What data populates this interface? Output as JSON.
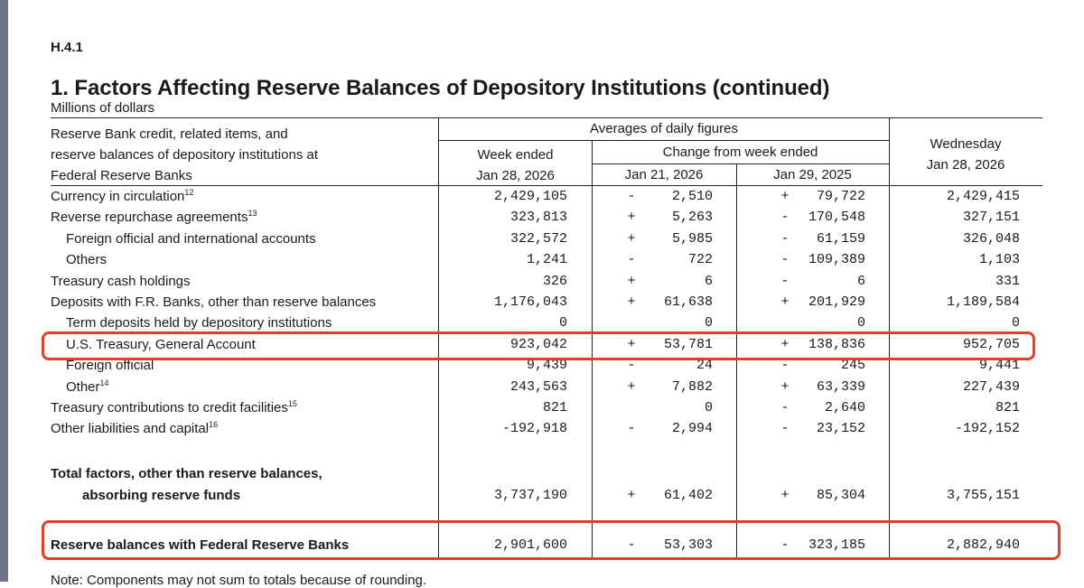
{
  "release_id": "H.4.1",
  "title": "1. Factors Affecting Reserve Balances of Depository Institutions (continued)",
  "units": "Millions of dollars",
  "header": {
    "item_col": [
      "Reserve Bank credit, related items, and",
      "reserve balances of depository institutions at",
      "Federal Reserve Banks"
    ],
    "averages": "Averages of daily figures",
    "week_ended": [
      "Week ended",
      "Jan 28, 2026"
    ],
    "change_from": "Change from week ended",
    "change_col1": "Jan 21, 2026",
    "change_col2": "Jan 29, 2025",
    "wednesday": [
      "Wednesday",
      "Jan 28, 2026"
    ]
  },
  "rows": [
    {
      "label": "Currency in circulation",
      "note": "12",
      "week": "2,429,105",
      "s1": "-",
      "c1": "2,510",
      "s2": "+",
      "c2": "79,722",
      "wed": "2,429,415"
    },
    {
      "label": "Reverse repurchase agreements",
      "note": "13",
      "week": "323,813",
      "s1": "+",
      "c1": "5,263",
      "s2": "-",
      "c2": "170,548",
      "wed": "327,151"
    },
    {
      "label": "Foreign official and international accounts",
      "note": "",
      "week": "322,572",
      "s1": "+",
      "c1": "5,985",
      "s2": "-",
      "c2": "61,159",
      "wed": "326,048"
    },
    {
      "label": "Others",
      "note": "",
      "week": "1,241",
      "s1": "-",
      "c1": "722",
      "s2": "-",
      "c2": "109,389",
      "wed": "1,103"
    },
    {
      "label": "Treasury cash holdings",
      "note": "",
      "week": "326",
      "s1": "+",
      "c1": "6",
      "s2": "-",
      "c2": "6",
      "wed": "331"
    },
    {
      "label": "Deposits with F.R. Banks, other than reserve balances",
      "note": "",
      "week": "1,176,043",
      "s1": "+",
      "c1": "61,638",
      "s2": "+",
      "c2": "201,929",
      "wed": "1,189,584"
    },
    {
      "label": "Term deposits held by depository institutions",
      "note": "",
      "week": "0",
      "s1": "",
      "c1": "0",
      "s2": "",
      "c2": "0",
      "wed": "0"
    },
    {
      "label": "U.S. Treasury, General Account",
      "note": "",
      "week": "923,042",
      "s1": "+",
      "c1": "53,781",
      "s2": "+",
      "c2": "138,836",
      "wed": "952,705"
    },
    {
      "label": "Foreign official",
      "note": "",
      "week": "9,439",
      "s1": "-",
      "c1": "24",
      "s2": "-",
      "c2": "245",
      "wed": "9,441"
    },
    {
      "label": "Other",
      "note": "14",
      "week": "243,563",
      "s1": "+",
      "c1": "7,882",
      "s2": "+",
      "c2": "63,339",
      "wed": "227,439"
    },
    {
      "label": "Treasury contributions to credit facilities",
      "note": "15",
      "week": "821",
      "s1": "",
      "c1": "0",
      "s2": "-",
      "c2": "2,640",
      "wed": "821"
    },
    {
      "label": "Other liabilities and capital",
      "note": "16",
      "week": "-192,918",
      "s1": "-",
      "c1": "2,994",
      "s2": "-",
      "c2": "23,152",
      "wed": "-192,152"
    }
  ],
  "total": {
    "label_line1": "Total factors, other than reserve balances,",
    "label_line2": "absorbing reserve funds",
    "week": "3,737,190",
    "s1": "+",
    "c1": "61,402",
    "s2": "+",
    "c2": "85,304",
    "wed": "3,755,151"
  },
  "reserve": {
    "label": "Reserve balances with Federal Reserve Banks",
    "week": "2,901,600",
    "s1": "-",
    "c1": "53,303",
    "s2": "-",
    "c2": "323,185",
    "wed": "2,882,940"
  },
  "note_text": "Note: Components may not sum to totals because of rounding.",
  "highlight_color": "#e0402a"
}
